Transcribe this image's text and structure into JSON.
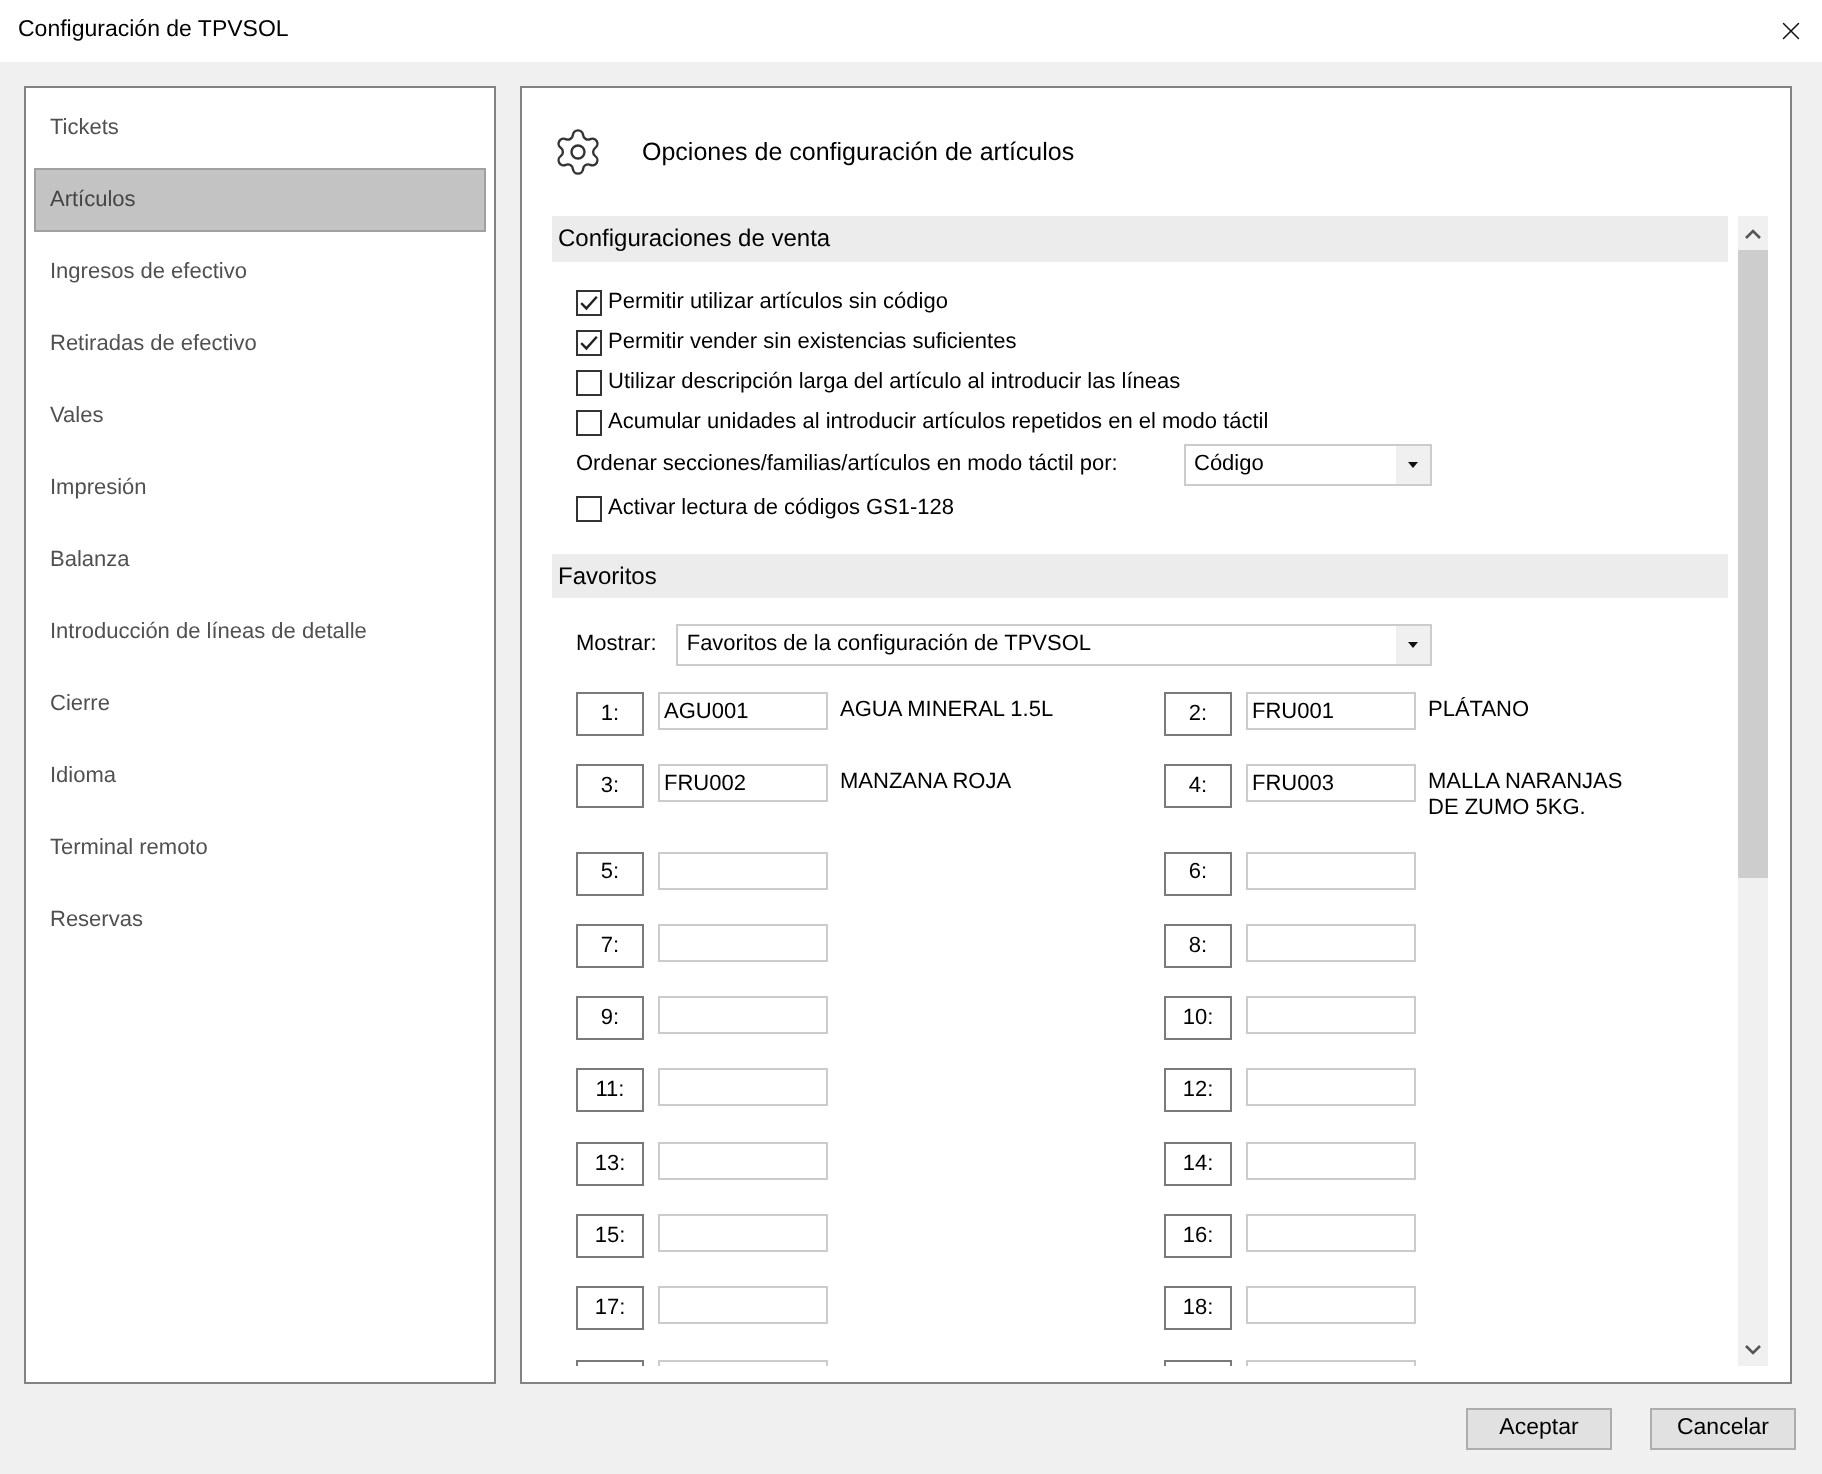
{
  "window": {
    "title": "Configuración de TPVSOL"
  },
  "sidebar": {
    "items": [
      {
        "label": "Tickets",
        "selected": false
      },
      {
        "label": "Artículos",
        "selected": true
      },
      {
        "label": "Ingresos de efectivo",
        "selected": false
      },
      {
        "label": "Retiradas de efectivo",
        "selected": false
      },
      {
        "label": "Vales",
        "selected": false
      },
      {
        "label": "Impresión",
        "selected": false
      },
      {
        "label": "Balanza",
        "selected": false
      },
      {
        "label": "Introducción de líneas de detalle",
        "selected": false
      },
      {
        "label": "Cierre",
        "selected": false
      },
      {
        "label": "Idioma",
        "selected": false
      },
      {
        "label": "Terminal remoto",
        "selected": false
      },
      {
        "label": "Reservas",
        "selected": false
      }
    ]
  },
  "panel": {
    "title": "Opciones de configuración de artículos"
  },
  "sections": [
    {
      "title": "Configuraciones de venta",
      "options": [
        {
          "kind": "checkbox",
          "label": "Permitir utilizar artículos sin código",
          "checked": true
        },
        {
          "kind": "checkbox",
          "label": "Permitir vender sin existencias suficientes",
          "checked": true
        },
        {
          "kind": "checkbox",
          "label": "Utilizar descripción larga del artículo al introducir las líneas",
          "checked": false
        },
        {
          "kind": "checkbox",
          "label": "Acumular unidades al introducir artículos repetidos en el modo táctil",
          "checked": false
        },
        {
          "kind": "select",
          "label": "Ordenar secciones/familias/artículos en modo táctil por:",
          "value": "Código"
        },
        {
          "kind": "checkbox",
          "label": "Activar lectura de códigos GS1-128",
          "checked": false
        }
      ]
    },
    {
      "title": "Favoritos",
      "options": [
        {
          "kind": "select",
          "label": "Mostrar:",
          "value": "Favoritos de la configuración de TPVSOL"
        }
      ],
      "favorites": [
        {
          "kind": "slot",
          "number": "1:",
          "code": "AGU001",
          "description": "AGUA MINERAL 1.5L"
        },
        {
          "kind": "slot",
          "number": "2:",
          "code": "FRU001",
          "description": "PLÁTANO"
        },
        {
          "kind": "slot",
          "number": "3:",
          "code": "FRU002",
          "description": "MANZANA ROJA"
        },
        {
          "kind": "slot",
          "number": "4:",
          "code": "FRU003",
          "description": "MALLA NARANJAS DE ZUMO 5KG."
        },
        {
          "kind": "slot",
          "number": "5:"
        },
        {
          "kind": "slot",
          "number": "6:"
        },
        {
          "kind": "slot",
          "number": "7:"
        },
        {
          "kind": "slot",
          "number": "8:"
        },
        {
          "kind": "slot",
          "number": "9:"
        },
        {
          "kind": "slot",
          "number": "10:"
        },
        {
          "kind": "slot",
          "number": "11:"
        },
        {
          "kind": "slot",
          "number": "12:"
        },
        {
          "kind": "slot",
          "number": "13:"
        },
        {
          "kind": "slot",
          "number": "14:"
        },
        {
          "kind": "slot",
          "number": "15:"
        },
        {
          "kind": "slot",
          "number": "16:"
        },
        {
          "kind": "slot",
          "number": "17:"
        },
        {
          "kind": "slot",
          "number": "18:"
        },
        {
          "kind": "partial"
        },
        {
          "kind": "partial"
        }
      ]
    }
  ],
  "buttons": [
    {
      "label": "Aceptar"
    },
    {
      "label": "Cancelar"
    }
  ]
}
